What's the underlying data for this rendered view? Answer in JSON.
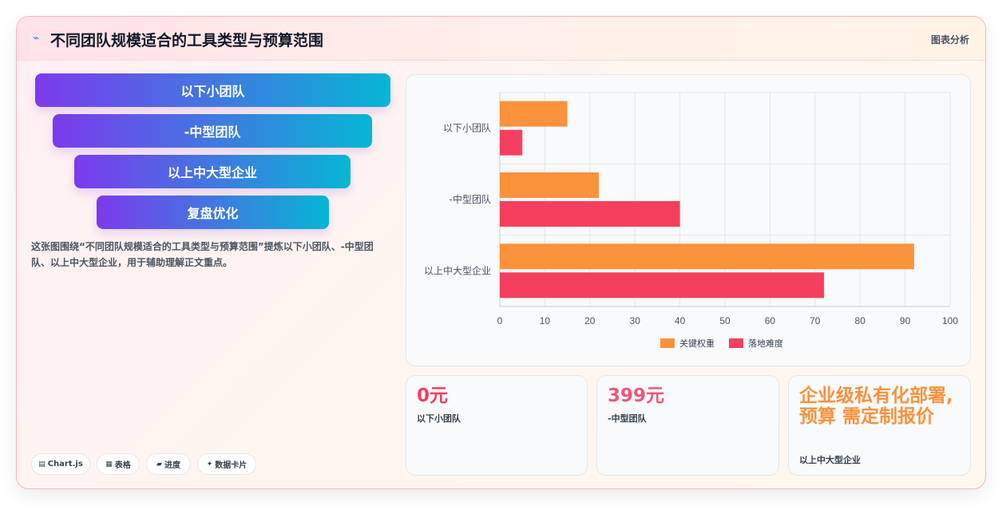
{
  "header": {
    "title": "不同团队规模适合的工具类型与预算范围",
    "title_icon": "⌁",
    "link": "图表分析"
  },
  "funnel": {
    "items": [
      "以下小团队",
      "-中型团队",
      "以上中大型企业",
      "复盘优化"
    ]
  },
  "description": "这张图围绕“不同团队规模适合的工具类型与预算范围”提炼以下小团队、-中型团队、以上中大型企业，用于辅助理解正文重点。",
  "chips": [
    {
      "icon": "▤",
      "label": "Chart.js"
    },
    {
      "icon": "▦",
      "label": "表格"
    },
    {
      "icon": "▰",
      "label": "进度"
    },
    {
      "icon": "✦",
      "label": "数据卡片"
    }
  ],
  "chart_data": {
    "type": "bar",
    "orientation": "horizontal",
    "categories": [
      "以下小团队",
      "-中型团队",
      "以上中大型企业"
    ],
    "series": [
      {
        "name": "关键权重",
        "color": "#fb923c",
        "values": [
          15,
          22,
          92
        ]
      },
      {
        "name": "落地难度",
        "color": "#f43f5e",
        "values": [
          5,
          40,
          72
        ]
      }
    ],
    "xlim": [
      0,
      100
    ],
    "x_ticks": [
      0,
      10,
      20,
      30,
      40,
      50,
      60,
      70,
      80,
      90,
      100
    ],
    "grid": true,
    "legend": "bottom"
  },
  "stats": [
    {
      "value": "0元",
      "label": "以下小团队",
      "color": "#f43f5e"
    },
    {
      "value": "399元",
      "label": "-中型团队",
      "color": "#f0567a"
    },
    {
      "value": "企业级私有化部署, 预算 需定制报价",
      "label": "以上中大型企业",
      "color": "#fb923c"
    }
  ]
}
